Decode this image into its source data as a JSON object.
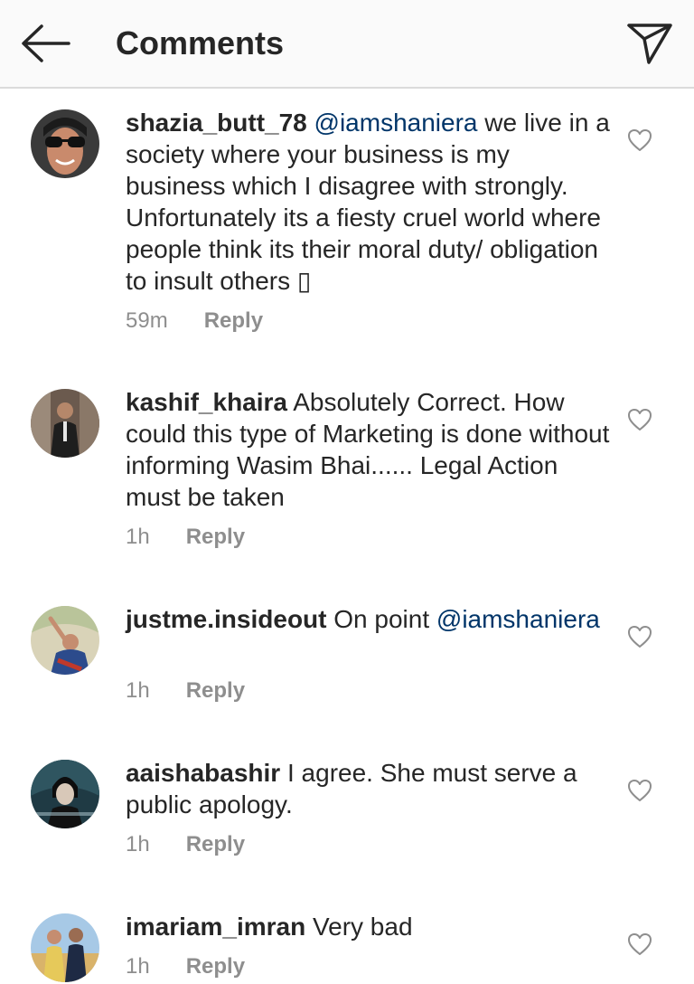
{
  "header": {
    "title": "Comments",
    "back_icon": "arrow-left-icon",
    "share_icon": "paper-plane-icon"
  },
  "comments": [
    {
      "username": "shazia_butt_78",
      "mention": "@iamshaniera",
      "text": "we live in a society where your business is my business which I disagree with strongly. Unfortunately its a fiesty cruel world where people think its their moral duty/ obligation to insult others ▯",
      "time": "59m",
      "reply_label": "Reply"
    },
    {
      "username": "kashif_khaira",
      "text": "Absolutely Correct. How could this type of Marketing is done without informing Wasim Bhai...... Legal Action must be taken",
      "time": "1h",
      "reply_label": "Reply"
    },
    {
      "username": "justme.insideout",
      "text": "On point",
      "mention": "@iamshaniera",
      "time": "1h",
      "reply_label": "Reply"
    },
    {
      "username": "aaishabashir",
      "text": "I agree. She must serve a public apology.",
      "time": "1h",
      "reply_label": "Reply"
    },
    {
      "username": "imariam_imran",
      "text": "Very bad",
      "time": "1h",
      "reply_label": "Reply"
    }
  ],
  "colors": {
    "header_bg": "#fafafa",
    "text": "#262626",
    "muted": "#8e8e8e",
    "mention": "#003569",
    "divider": "#dbdbdb"
  }
}
